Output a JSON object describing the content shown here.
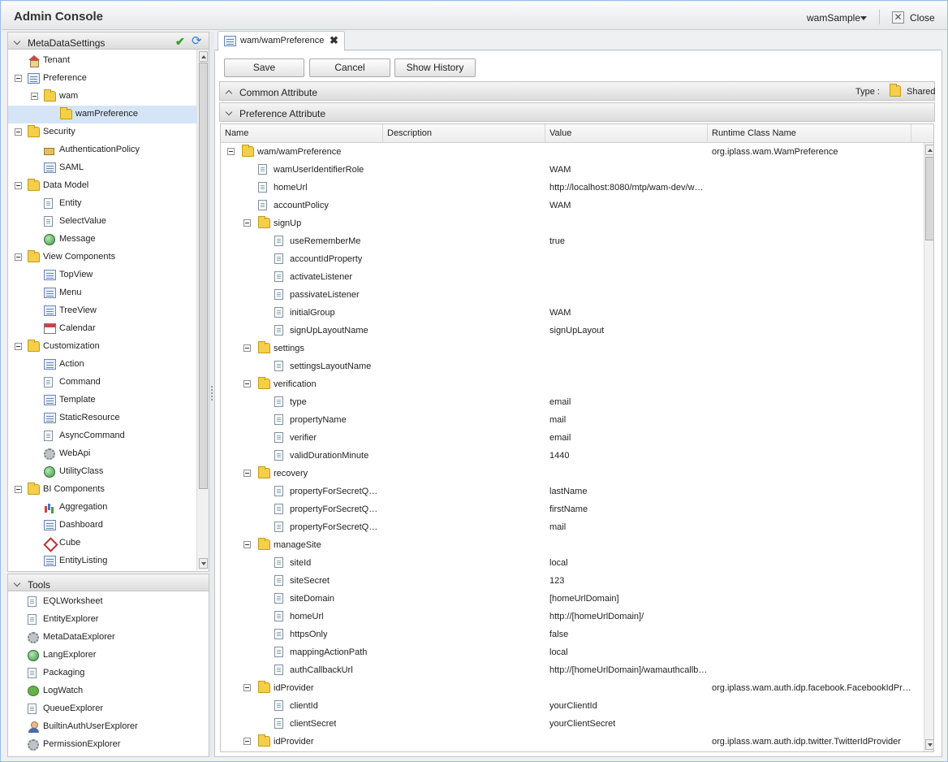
{
  "app": {
    "title": "Admin Console",
    "user": "wamSample",
    "close_label": "Close"
  },
  "left_panel": {
    "header": "MetaDataSettings",
    "tree": [
      {
        "label": "Tenant",
        "icon": "tenant-icon",
        "level": 0,
        "expandable": false
      },
      {
        "label": "Preference",
        "icon": "preference-icon",
        "level": 0,
        "expandable": true
      },
      {
        "label": "wam",
        "icon": "folder-icon",
        "level": 1,
        "expandable": true
      },
      {
        "label": "wamPreference",
        "icon": "preference-item-icon",
        "level": 2,
        "expandable": false,
        "selected": true
      },
      {
        "label": "Security",
        "icon": "folder-icon",
        "level": 0,
        "expandable": true
      },
      {
        "label": "AuthenticationPolicy",
        "icon": "auth-policy-icon",
        "level": 1,
        "expandable": false
      },
      {
        "label": "SAML",
        "icon": "saml-icon",
        "level": 1,
        "expandable": false
      },
      {
        "label": "Data Model",
        "icon": "folder-icon",
        "level": 0,
        "expandable": true
      },
      {
        "label": "Entity",
        "icon": "entity-icon",
        "level": 1,
        "expandable": false
      },
      {
        "label": "SelectValue",
        "icon": "select-value-icon",
        "level": 1,
        "expandable": false
      },
      {
        "label": "Message",
        "icon": "message-icon",
        "level": 1,
        "expandable": false
      },
      {
        "label": "View Components",
        "icon": "folder-icon",
        "level": 0,
        "expandable": true
      },
      {
        "label": "TopView",
        "icon": "top-view-icon",
        "level": 1,
        "expandable": false
      },
      {
        "label": "Menu",
        "icon": "menu-icon",
        "level": 1,
        "expandable": false
      },
      {
        "label": "TreeView",
        "icon": "tree-view-icon",
        "level": 1,
        "expandable": false
      },
      {
        "label": "Calendar",
        "icon": "calendar-icon",
        "level": 1,
        "expandable": false
      },
      {
        "label": "Customization",
        "icon": "folder-icon",
        "level": 0,
        "expandable": true
      },
      {
        "label": "Action",
        "icon": "action-icon",
        "level": 1,
        "expandable": false
      },
      {
        "label": "Command",
        "icon": "command-icon",
        "level": 1,
        "expandable": false
      },
      {
        "label": "Template",
        "icon": "template-icon",
        "level": 1,
        "expandable": false
      },
      {
        "label": "StaticResource",
        "icon": "static-resource-icon",
        "level": 1,
        "expandable": false
      },
      {
        "label": "AsyncCommand",
        "icon": "async-command-icon",
        "level": 1,
        "expandable": false
      },
      {
        "label": "WebApi",
        "icon": "web-api-icon",
        "level": 1,
        "expandable": false
      },
      {
        "label": "UtilityClass",
        "icon": "utility-class-icon",
        "level": 1,
        "expandable": false
      },
      {
        "label": "BI Components",
        "icon": "folder-icon",
        "level": 0,
        "expandable": true
      },
      {
        "label": "Aggregation",
        "icon": "aggregation-icon",
        "level": 1,
        "expandable": false
      },
      {
        "label": "Dashboard",
        "icon": "dashboard-icon",
        "level": 1,
        "expandable": false
      },
      {
        "label": "Cube",
        "icon": "cube-icon",
        "level": 1,
        "expandable": false
      },
      {
        "label": "EntityListing",
        "icon": "entity-listing-icon",
        "level": 1,
        "expandable": false
      }
    ],
    "tools_header": "Tools",
    "tools": [
      {
        "label": "EQLWorksheet",
        "icon": "eql-worksheet-icon"
      },
      {
        "label": "EntityExplorer",
        "icon": "entity-explorer-icon"
      },
      {
        "label": "MetaDataExplorer",
        "icon": "metadata-explorer-icon"
      },
      {
        "label": "LangExplorer",
        "icon": "lang-explorer-icon"
      },
      {
        "label": "Packaging",
        "icon": "packaging-icon"
      },
      {
        "label": "LogWatch",
        "icon": "log-watch-icon"
      },
      {
        "label": "QueueExplorer",
        "icon": "queue-explorer-icon"
      },
      {
        "label": "BuiltinAuthUserExplorer",
        "icon": "builtin-auth-user-explorer-icon"
      },
      {
        "label": "PermissionExplorer",
        "icon": "permission-explorer-icon"
      }
    ]
  },
  "main": {
    "tab_label": "wam/wamPreference",
    "buttons": {
      "save": "Save",
      "cancel": "Cancel",
      "history": "Show History"
    },
    "common_attribute": {
      "label": "Common Attribute",
      "type_label": "Type :",
      "type_value": "Shared"
    },
    "preference_attribute": {
      "label": "Preference Attribute"
    },
    "columns": [
      "Name",
      "Description",
      "Value",
      "Runtime Class Name"
    ],
    "rows": [
      {
        "name": "wam/wamPreference",
        "level": 0,
        "folder": true,
        "value": "",
        "class": "org.iplass.wam.WamPreference"
      },
      {
        "name": "wamUserIdentifierRole",
        "level": 1,
        "folder": false,
        "value": "WAM",
        "class": ""
      },
      {
        "name": "homeUrl",
        "level": 1,
        "folder": false,
        "value": "http://localhost:8080/mtp/wam-dev/wa…",
        "class": ""
      },
      {
        "name": "accountPolicy",
        "level": 1,
        "folder": false,
        "value": "WAM",
        "class": ""
      },
      {
        "name": "signUp",
        "level": 1,
        "folder": true,
        "value": "",
        "class": ""
      },
      {
        "name": "useRememberMe",
        "level": 2,
        "folder": false,
        "value": "true",
        "class": ""
      },
      {
        "name": "accountIdProperty",
        "level": 2,
        "folder": false,
        "value": "",
        "class": ""
      },
      {
        "name": "activateListener",
        "level": 2,
        "folder": false,
        "value": "",
        "class": ""
      },
      {
        "name": "passivateListener",
        "level": 2,
        "folder": false,
        "value": "",
        "class": ""
      },
      {
        "name": "initialGroup",
        "level": 2,
        "folder": false,
        "value": "WAM",
        "class": ""
      },
      {
        "name": "signUpLayoutName",
        "level": 2,
        "folder": false,
        "value": "signUpLayout",
        "class": ""
      },
      {
        "name": "settings",
        "level": 1,
        "folder": true,
        "value": "",
        "class": ""
      },
      {
        "name": "settingsLayoutName",
        "level": 2,
        "folder": false,
        "value": "",
        "class": ""
      },
      {
        "name": "verification",
        "level": 1,
        "folder": true,
        "value": "",
        "class": ""
      },
      {
        "name": "type",
        "level": 2,
        "folder": false,
        "value": "email",
        "class": ""
      },
      {
        "name": "propertyName",
        "level": 2,
        "folder": false,
        "value": "mail",
        "class": ""
      },
      {
        "name": "verifier",
        "level": 2,
        "folder": false,
        "value": "email",
        "class": ""
      },
      {
        "name": "validDurationMinute",
        "level": 2,
        "folder": false,
        "value": "1440",
        "class": ""
      },
      {
        "name": "recovery",
        "level": 1,
        "folder": true,
        "value": "",
        "class": ""
      },
      {
        "name": "propertyForSecretQ…",
        "level": 2,
        "folder": false,
        "value": "lastName",
        "class": ""
      },
      {
        "name": "propertyForSecretQ…",
        "level": 2,
        "folder": false,
        "value": "firstName",
        "class": ""
      },
      {
        "name": "propertyForSecretQ…",
        "level": 2,
        "folder": false,
        "value": "mail",
        "class": ""
      },
      {
        "name": "manageSite",
        "level": 1,
        "folder": true,
        "value": "",
        "class": ""
      },
      {
        "name": "siteId",
        "level": 2,
        "folder": false,
        "value": "local",
        "class": ""
      },
      {
        "name": "siteSecret",
        "level": 2,
        "folder": false,
        "value": "123",
        "class": ""
      },
      {
        "name": "siteDomain",
        "level": 2,
        "folder": false,
        "value": "[homeUrlDomain]",
        "class": ""
      },
      {
        "name": "homeUrl",
        "level": 2,
        "folder": false,
        "value": "http://[homeUrlDomain]/",
        "class": ""
      },
      {
        "name": "httpsOnly",
        "level": 2,
        "folder": false,
        "value": "false",
        "class": ""
      },
      {
        "name": "mappingActionPath",
        "level": 2,
        "folder": false,
        "value": "local",
        "class": ""
      },
      {
        "name": "authCallbackUrl",
        "level": 2,
        "folder": false,
        "value": "http://[homeUrlDomain]/wamauthcallb…",
        "class": ""
      },
      {
        "name": "idProvider",
        "level": 1,
        "folder": true,
        "value": "",
        "class": "org.iplass.wam.auth.idp.facebook.FacebookIdPr…"
      },
      {
        "name": "clientId",
        "level": 2,
        "folder": false,
        "value": "yourClientId",
        "class": ""
      },
      {
        "name": "clientSecret",
        "level": 2,
        "folder": false,
        "value": "yourClientSecret",
        "class": ""
      },
      {
        "name": "idProvider",
        "level": 1,
        "folder": true,
        "value": "",
        "class": "org.iplass.wam.auth.idp.twitter.TwitterIdProvider"
      }
    ]
  },
  "colors": {
    "accent": "#2a7fd4",
    "selected_row": "#d5e5f7",
    "folder": "#f5cf4a"
  }
}
